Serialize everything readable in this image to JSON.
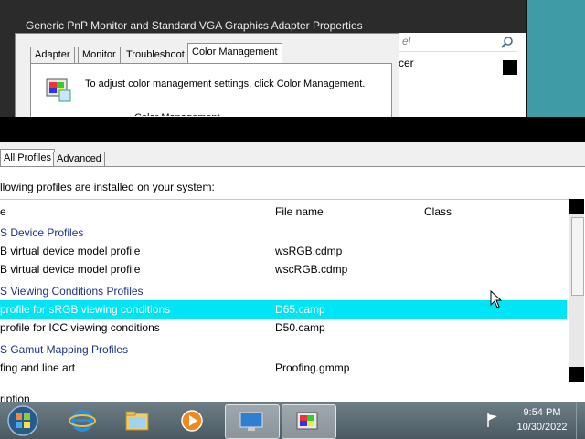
{
  "back_window": {
    "title": "Generic PnP Monitor and Standard VGA Graphics Adapter Properties",
    "tabs": [
      "Adapter",
      "Monitor",
      "Troubleshoot",
      "Color Management"
    ],
    "active_tab": "Color Management",
    "message": "To adjust color management settings, click Color Management.",
    "button_label_partial": "Color Management...",
    "search_placeholder": "el",
    "right_text": "cer"
  },
  "cm_window": {
    "tabs": [
      "All Profiles",
      "Advanced"
    ],
    "description": "llowing profiles are installed on your system:",
    "columns": [
      "e",
      "File name",
      "Class"
    ],
    "rows": [
      {
        "name": "S Device Profiles",
        "file": "",
        "group": true
      },
      {
        "name": "B virtual device model profile",
        "file": "wsRGB.cdmp",
        "group": false
      },
      {
        "name": "B virtual device model profile",
        "file": "wscRGB.cdmp",
        "group": false
      },
      {
        "name": "S Viewing Conditions Profiles",
        "file": "",
        "group": true
      },
      {
        "name": "profile for sRGB viewing conditions",
        "file": "D65.camp",
        "group": false,
        "selected": true
      },
      {
        "name": "profile for ICC viewing conditions",
        "file": "D50.camp",
        "group": false
      },
      {
        "name": "S Gamut Mapping Profiles",
        "file": "",
        "group": true
      },
      {
        "name": "fing and line art",
        "file": "Proofing.gmmp",
        "group": false
      }
    ],
    "bottom_label": "ription"
  },
  "taskbar": {
    "time": "9:54 PM",
    "date": "10/30/2022",
    "icons": [
      "internet-explorer-icon",
      "file-explorer-icon",
      "media-player-icon",
      "display-settings-icon",
      "color-management-icon"
    ]
  },
  "colors": {
    "selection": "#00e5f5",
    "group_text": "#1e3287",
    "desktop": "#3f9ba6"
  }
}
